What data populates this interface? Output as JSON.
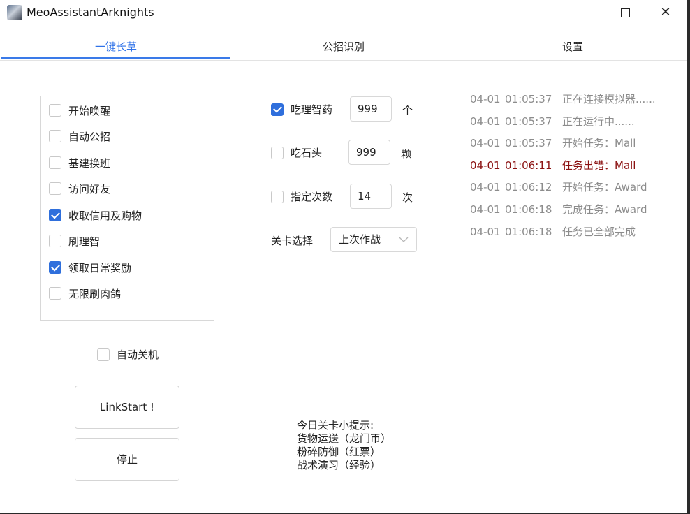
{
  "window": {
    "title": "MeoAssistantArknights"
  },
  "tabs": [
    {
      "label": "一键长草",
      "active": true
    },
    {
      "label": "公招识别",
      "active": false
    },
    {
      "label": "设置",
      "active": false
    }
  ],
  "tasks": [
    {
      "label": "开始唤醒",
      "checked": false
    },
    {
      "label": "自动公招",
      "checked": false
    },
    {
      "label": "基建换班",
      "checked": false
    },
    {
      "label": "访问好友",
      "checked": false
    },
    {
      "label": "收取信用及购物",
      "checked": true
    },
    {
      "label": "刷理智",
      "checked": false
    },
    {
      "label": "领取日常奖励",
      "checked": true
    },
    {
      "label": "无限刷肉鸽",
      "checked": false
    }
  ],
  "options": {
    "medicine": {
      "label": "吃理智药",
      "checked": true,
      "value": "999",
      "unit": "个"
    },
    "stone": {
      "label": "吃石头",
      "checked": false,
      "value": "999",
      "unit": "颗"
    },
    "times": {
      "label": "指定次数",
      "checked": false,
      "value": "14",
      "unit": "次"
    },
    "stage": {
      "label": "关卡选择",
      "value": "上次作战"
    }
  },
  "log": [
    {
      "date": "04-01",
      "time": "01:05:37",
      "msg": "正在连接模拟器......",
      "error": false
    },
    {
      "date": "04-01",
      "time": "01:05:37",
      "msg": "正在运行中......",
      "error": false
    },
    {
      "date": "04-01",
      "time": "01:05:37",
      "msg": "开始任务：Mall",
      "error": false
    },
    {
      "date": "04-01",
      "time": "01:06:11",
      "msg": "任务出错：Mall",
      "error": true
    },
    {
      "date": "04-01",
      "time": "01:06:12",
      "msg": "开始任务：Award",
      "error": false
    },
    {
      "date": "04-01",
      "time": "01:06:18",
      "msg": "完成任务：Award",
      "error": false
    },
    {
      "date": "04-01",
      "time": "01:06:18",
      "msg": "任务已全部完成",
      "error": false
    }
  ],
  "shutdown": {
    "label": "自动关机",
    "checked": false
  },
  "buttons": {
    "start": "LinkStart !",
    "stop": "停止"
  },
  "tips": {
    "title": "今日关卡小提示:",
    "lines": [
      "货物运送（龙门币）",
      "粉碎防御（红票）",
      "战术演习（经验）"
    ]
  },
  "colors": {
    "accent": "#3a7ae8",
    "error": "#8b1212",
    "log": "#8c8c8c"
  }
}
